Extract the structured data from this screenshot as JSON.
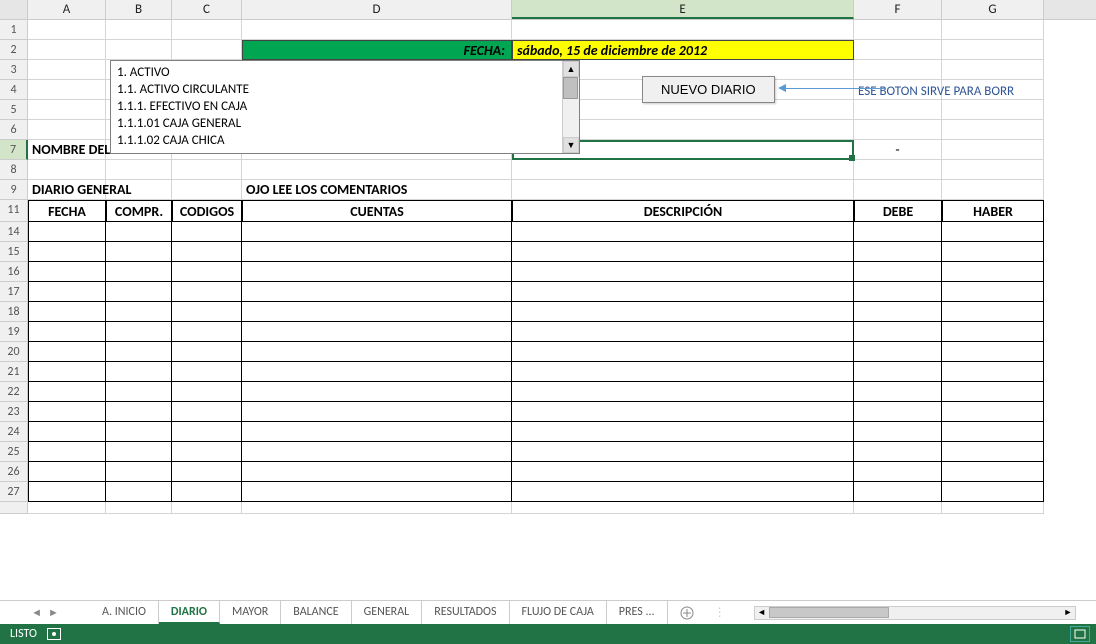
{
  "columns": [
    "A",
    "B",
    "C",
    "D",
    "E",
    "F",
    "G"
  ],
  "selected_column": "E",
  "rows_shown": [
    1,
    2,
    3,
    4,
    5,
    6,
    7,
    8,
    9,
    11,
    14,
    15,
    16,
    17,
    18,
    19,
    20,
    21,
    22,
    23,
    24,
    25,
    26,
    27
  ],
  "selected_row": 7,
  "fecha_label": "FECHA:",
  "fecha_value": "sábado, 15 de diciembre de 2012",
  "listbox_items": [
    "1. ACTIVO",
    "1.1. ACTIVO CIRCULANTE",
    "1.1.1. EFECTIVO EN CAJA",
    "1.1.1.01 CAJA GENERAL",
    "1.1.1.02 CAJA CHICA"
  ],
  "button_label": "NUEVO DIARIO",
  "note_text": "ESE BOTON SIRVE PARA BORR",
  "row7_text": "NOMBRE DEL NEGOCIO",
  "row7_dash": "-",
  "row9_a": "DIARIO GENERAL",
  "row9_d": "OJO LEE LOS COMENTARIOS",
  "table_headers": [
    "FECHA",
    "COMPR.",
    "CODIGOS",
    "CUENTAS",
    "DESCRIPCIÓN",
    "DEBE",
    "HABER"
  ],
  "sheet_tabs": [
    "A. INICIO",
    "DIARIO",
    "MAYOR",
    "BALANCE",
    "GENERAL",
    "RESULTADOS",
    "FLUJO DE CAJA",
    "PRES ..."
  ],
  "active_tab": "DIARIO",
  "status_text": "LISTO"
}
